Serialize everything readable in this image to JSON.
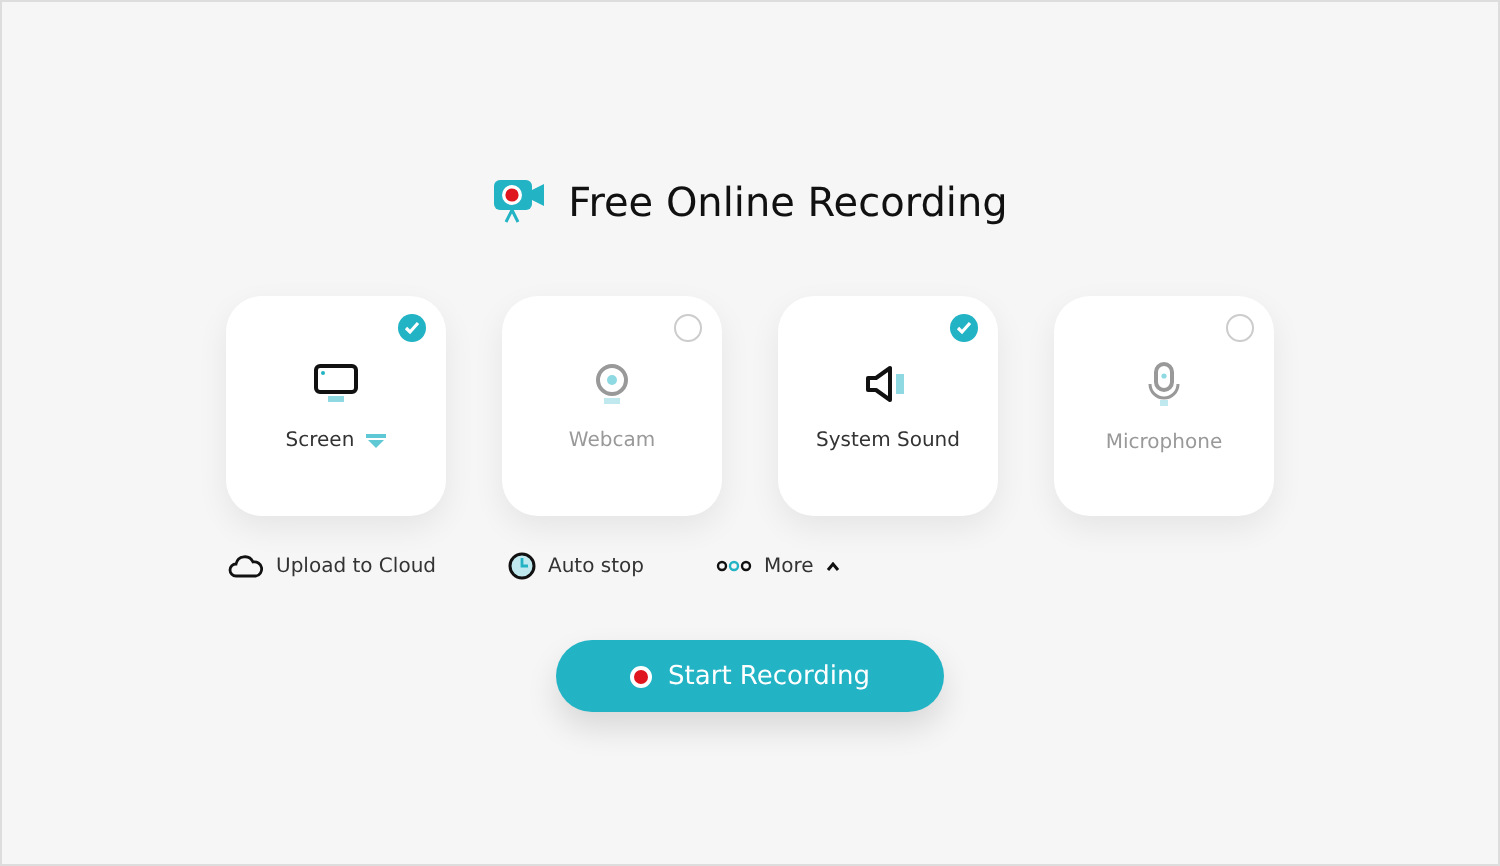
{
  "title": "Free Online Recording",
  "sources": [
    {
      "kind": "screen",
      "label": "Screen",
      "checked": true,
      "has_menu": true
    },
    {
      "kind": "webcam",
      "label": "Webcam",
      "checked": false,
      "has_menu": false
    },
    {
      "kind": "sound",
      "label": "System Sound",
      "checked": true,
      "has_menu": false
    },
    {
      "kind": "mic",
      "label": "Microphone",
      "checked": false,
      "has_menu": false
    }
  ],
  "options": [
    {
      "kind": "cloud",
      "label": "Upload to Cloud"
    },
    {
      "kind": "timer",
      "label": "Auto stop"
    },
    {
      "kind": "more",
      "label": "More",
      "expanded": true
    }
  ],
  "start_button": {
    "label": "Start Recording"
  }
}
